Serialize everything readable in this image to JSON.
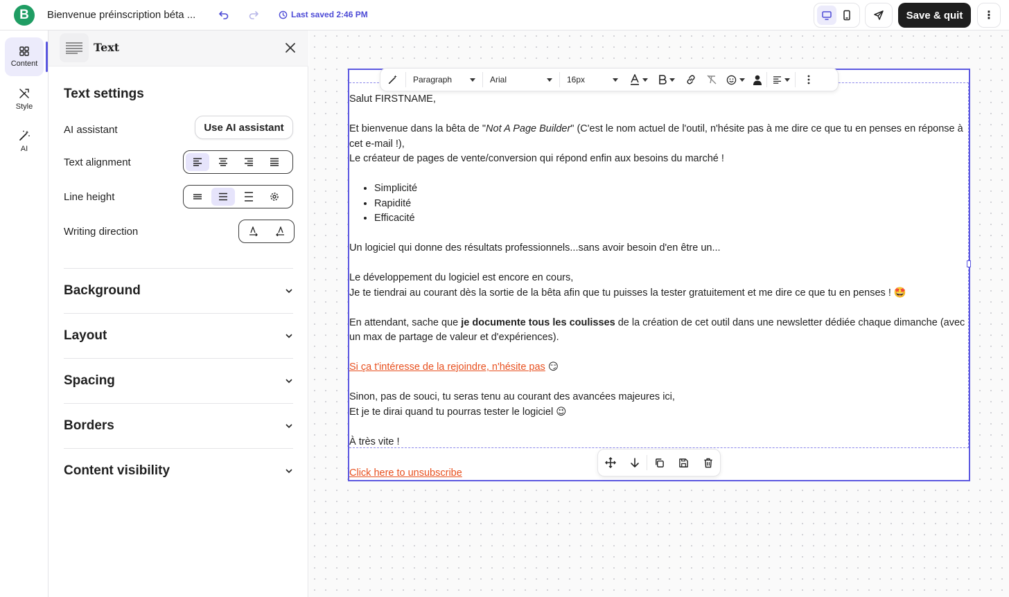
{
  "header": {
    "logo_letter": "B",
    "doc_title": "Bienvenue préinscription béta ...",
    "last_saved": "Last saved 2:46 PM",
    "save_quit_label": "Save & quit",
    "more_label": "⋮",
    "accent_color": "#4c4ad6"
  },
  "rail": {
    "items": [
      {
        "label": "Content",
        "icon": "grid-icon",
        "active": true
      },
      {
        "label": "Style",
        "icon": "brush-icon",
        "active": false
      },
      {
        "label": "AI",
        "icon": "magic-wand-icon",
        "active": false
      }
    ]
  },
  "panel": {
    "title": "Text",
    "settings_title": "Text settings",
    "ai_assistant_label": "AI assistant",
    "ai_assistant_button": "Use AI assistant",
    "text_alignment_label": "Text alignment",
    "line_height_label": "Line height",
    "writing_direction_label": "Writing direction",
    "sections": [
      "Background",
      "Layout",
      "Spacing",
      "Borders",
      "Content visibility"
    ]
  },
  "toolbar": {
    "block_type": "Paragraph",
    "font_family": "Arial",
    "font_size": "16px"
  },
  "email": {
    "greeting": "Salut FIRSTNAME,",
    "p1_a": "Et bienvenue dans la bêta de \"",
    "p1_em": "Not A Page Builder",
    "p1_b": "\" (C'est le nom actuel de l'outil, n'hésite pas à me dire ce que tu en penses en réponse à cet e-mail !),",
    "p2": "Le créateur de pages de vente/conversion qui répond enfin aux besoins du marché !",
    "bullets": [
      "Simplicité",
      "Rapidité",
      "Efficacité"
    ],
    "p3": "Un logiciel qui donne des résultats professionnels...sans avoir besoin d'en être un...",
    "p4": "Le développement du logiciel est encore en cours,",
    "p5": "Je te tiendrai au courant dès la sortie de la bêta afin que tu puisses la tester gratuitement et me dire ce que tu en penses ! 🤩",
    "p6_a": "En attendant, sache que ",
    "p6_strong": "je documente tous les coulisses",
    "p6_b": " de la création de cet outil dans une newsletter dédiée chaque dimanche (avec un max de partage de valeur et d'expériences).",
    "p7_link": "Si ça t'intéresse de la rejoindre, n'hésite pas",
    "p7_emoji": " 😏",
    "p8": "Sinon, pas de souci, tu seras tenu au courant des avancées majeures ici,",
    "p9": "Et je te dirai quand tu pourras tester le logiciel 😉",
    "p10": "À très vite !",
    "unsubscribe": "Click here to unsubscribe",
    "link_color": "#e8501f"
  }
}
